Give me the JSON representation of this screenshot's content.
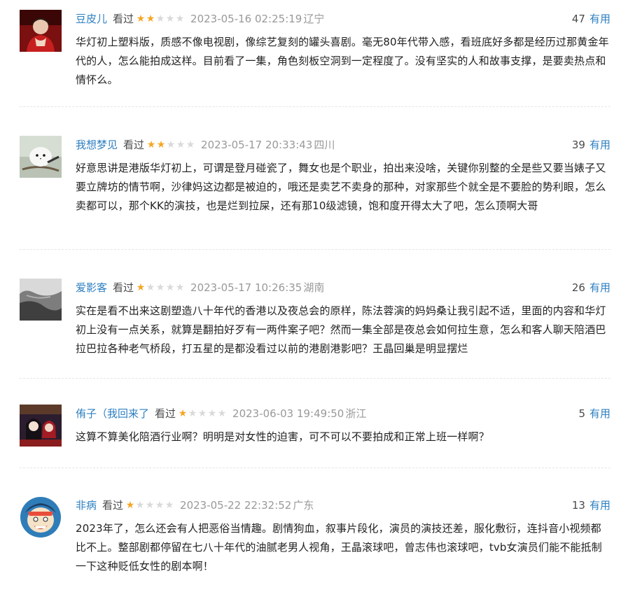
{
  "comments": [
    {
      "username": "豆皮儿",
      "watched": "看过",
      "rating": 2,
      "time": "2023-05-16 02:25:19",
      "location": "辽宁",
      "votes": "47",
      "vote_label": "有用",
      "avatar": "avatar-photo-red",
      "content": "华灯初上塑料版，质感不像电视剧，像综艺复刻的罐头喜剧。毫无80年代带入感，看班底好多都是经历过那黄金年代的人，怎么能拍成这样。目前看了一集，角色刻板空洞到一定程度了。没有坚实的人和故事支撑，是要卖热点和情怀么。"
    },
    {
      "username": "我想梦见",
      "watched": "看过",
      "rating": 2,
      "time": "2023-05-17 20:33:43",
      "location": "四川",
      "votes": "39",
      "vote_label": "有用",
      "avatar": "avatar-white-bird",
      "content": "好意思讲是港版华灯初上，可谓是登月碰瓷了，舞女也是个职业，拍出来没啥，关键你别整的全是些又要当婊子又要立牌坊的情节啊，沙律妈这边都是被迫的，哦还是卖艺不卖身的那种，对家那些个就全是不要脸的势利眼，怎么卖都可以，那个KK的演技，也是烂到拉屎，还有那10级滤镜，饱和度开得太大了吧，怎么顶啊大哥"
    },
    {
      "username": "爱影客",
      "watched": "看过",
      "rating": 1,
      "time": "2023-05-17 10:26:35",
      "location": "湖南",
      "votes": "26",
      "vote_label": "有用",
      "avatar": "avatar-grey-bw",
      "content": "实在是看不出来这剧塑造八十年代的香港以及夜总会的原样，陈法蓉演的妈妈桑让我引起不适，里面的内容和华灯初上没有一点关系，就算是翻拍好歹有一两件案子吧？然而一集全部是夜总会如何拉生意，怎么和客人聊天陪酒巴拉巴拉各种老气桥段，打五星的是都没看过以前的港剧港影吧？王晶回巢是明显摆烂"
    },
    {
      "username": "侑子（我回来了",
      "watched": "看过",
      "rating": 1,
      "time": "2023-06-03 19:49:50",
      "location": "浙江",
      "votes": "5",
      "vote_label": "有用",
      "avatar": "avatar-anime",
      "content": "这算不算美化陪酒行业啊？明明是对女性的迫害，可不可以不要拍成和正常上班一样啊？"
    },
    {
      "username": "非病",
      "watched": "看过",
      "rating": 1,
      "time": "2023-05-22 22:32:52",
      "location": "广东",
      "votes": "13",
      "vote_label": "有用",
      "avatar": "avatar-cartoon-face",
      "content": "2023年了，怎么还会有人把恶俗当情趣。剧情狗血，叙事片段化，演员的演技还差，服化敷衍，连抖音小视频都比不上。整部剧都停留在七八十年代的油腻老男人视角，王晶滚球吧，曾志伟也滚球吧，tvb女演员们能不能抵制一下这种贬低女性的剧本啊！"
    }
  ],
  "colors": {
    "username": "#2d7fc1",
    "star_on": "#f5a623",
    "star_off": "#d9d9d9",
    "muted": "#999999"
  }
}
